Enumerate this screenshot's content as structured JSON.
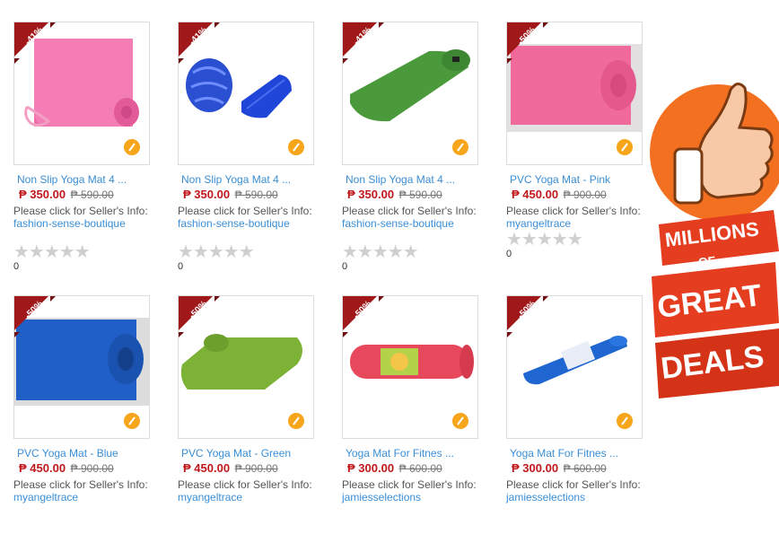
{
  "products": [
    {
      "discount": "-41%",
      "title": "Non Slip Yoga Mat 4 ...",
      "price": "₱ 350.00",
      "old_price": "₱ 590.00",
      "seller_prefix": "Please click for Seller's Info:",
      "seller": "fashion-sense-boutique",
      "stars": "★★★★★",
      "count": "0",
      "image": "pink-yoga-mat-with-strap"
    },
    {
      "discount": "-41%",
      "title": "Non Slip Yoga Mat 4 ...",
      "price": "₱ 350.00",
      "old_price": "₱ 590.00",
      "seller_prefix": "Please click for Seller's Info:",
      "seller": "fashion-sense-boutique",
      "stars": "★★★★★",
      "count": "0",
      "image": "blue-yoga-mat-with-bag"
    },
    {
      "discount": "-41%",
      "title": "Non Slip Yoga Mat 4 ...",
      "price": "₱ 350.00",
      "old_price": "₱ 590.00",
      "seller_prefix": "Please click for Seller's Info:",
      "seller": "fashion-sense-boutique",
      "stars": "★★★★★",
      "count": "0",
      "image": "green-yoga-mat"
    },
    {
      "discount": "-50%",
      "title": "PVC Yoga Mat - Pink",
      "price": "₱ 450.00",
      "old_price": "₱ 900.00",
      "seller_prefix": "Please click for Seller's Info:",
      "seller": "myangeltrace",
      "stars": "★★★★★",
      "count": "0",
      "image": "pink-pvc-yoga-mat"
    },
    {
      "discount": "-50%",
      "title": "PVC Yoga Mat - Blue",
      "price": "₱ 450.00",
      "old_price": "₱ 900.00",
      "seller_prefix": "Please click for Seller's Info:",
      "seller": "myangeltrace",
      "image": "blue-pvc-yoga-mat"
    },
    {
      "discount": "-50%",
      "title": "PVC Yoga Mat - Green",
      "price": "₱ 450.00",
      "old_price": "₱ 900.00",
      "seller_prefix": "Please click for Seller's Info:",
      "seller": "myangeltrace",
      "image": "green-pvc-yoga-mat"
    },
    {
      "discount": "-50%",
      "title": "Yoga Mat For Fitnes ...",
      "price": "₱ 300.00",
      "old_price": "₱ 600.00",
      "seller_prefix": "Please click for Seller's Info:",
      "seller": "jamiesselections",
      "image": "red-rolled-yoga-mat"
    },
    {
      "discount": "-50%",
      "title": "Yoga Mat For Fitnes ...",
      "price": "₱ 300.00",
      "old_price": "₱ 600.00",
      "seller_prefix": "Please click for Seller's Info:",
      "seller": "jamiesselections",
      "image": "blue-rolled-yoga-mat"
    }
  ],
  "promo": {
    "line1": "MILLIONS",
    "line2": "-OF-",
    "line3": "GREAT",
    "line4": "DEALS",
    "icon": "thumbs-up-icon"
  },
  "colors": {
    "badge": "#a1181b",
    "price": "#c0171b",
    "link": "#3a8ed6",
    "promo_orange": "#f37021",
    "banner_red": "#e53d1f"
  }
}
